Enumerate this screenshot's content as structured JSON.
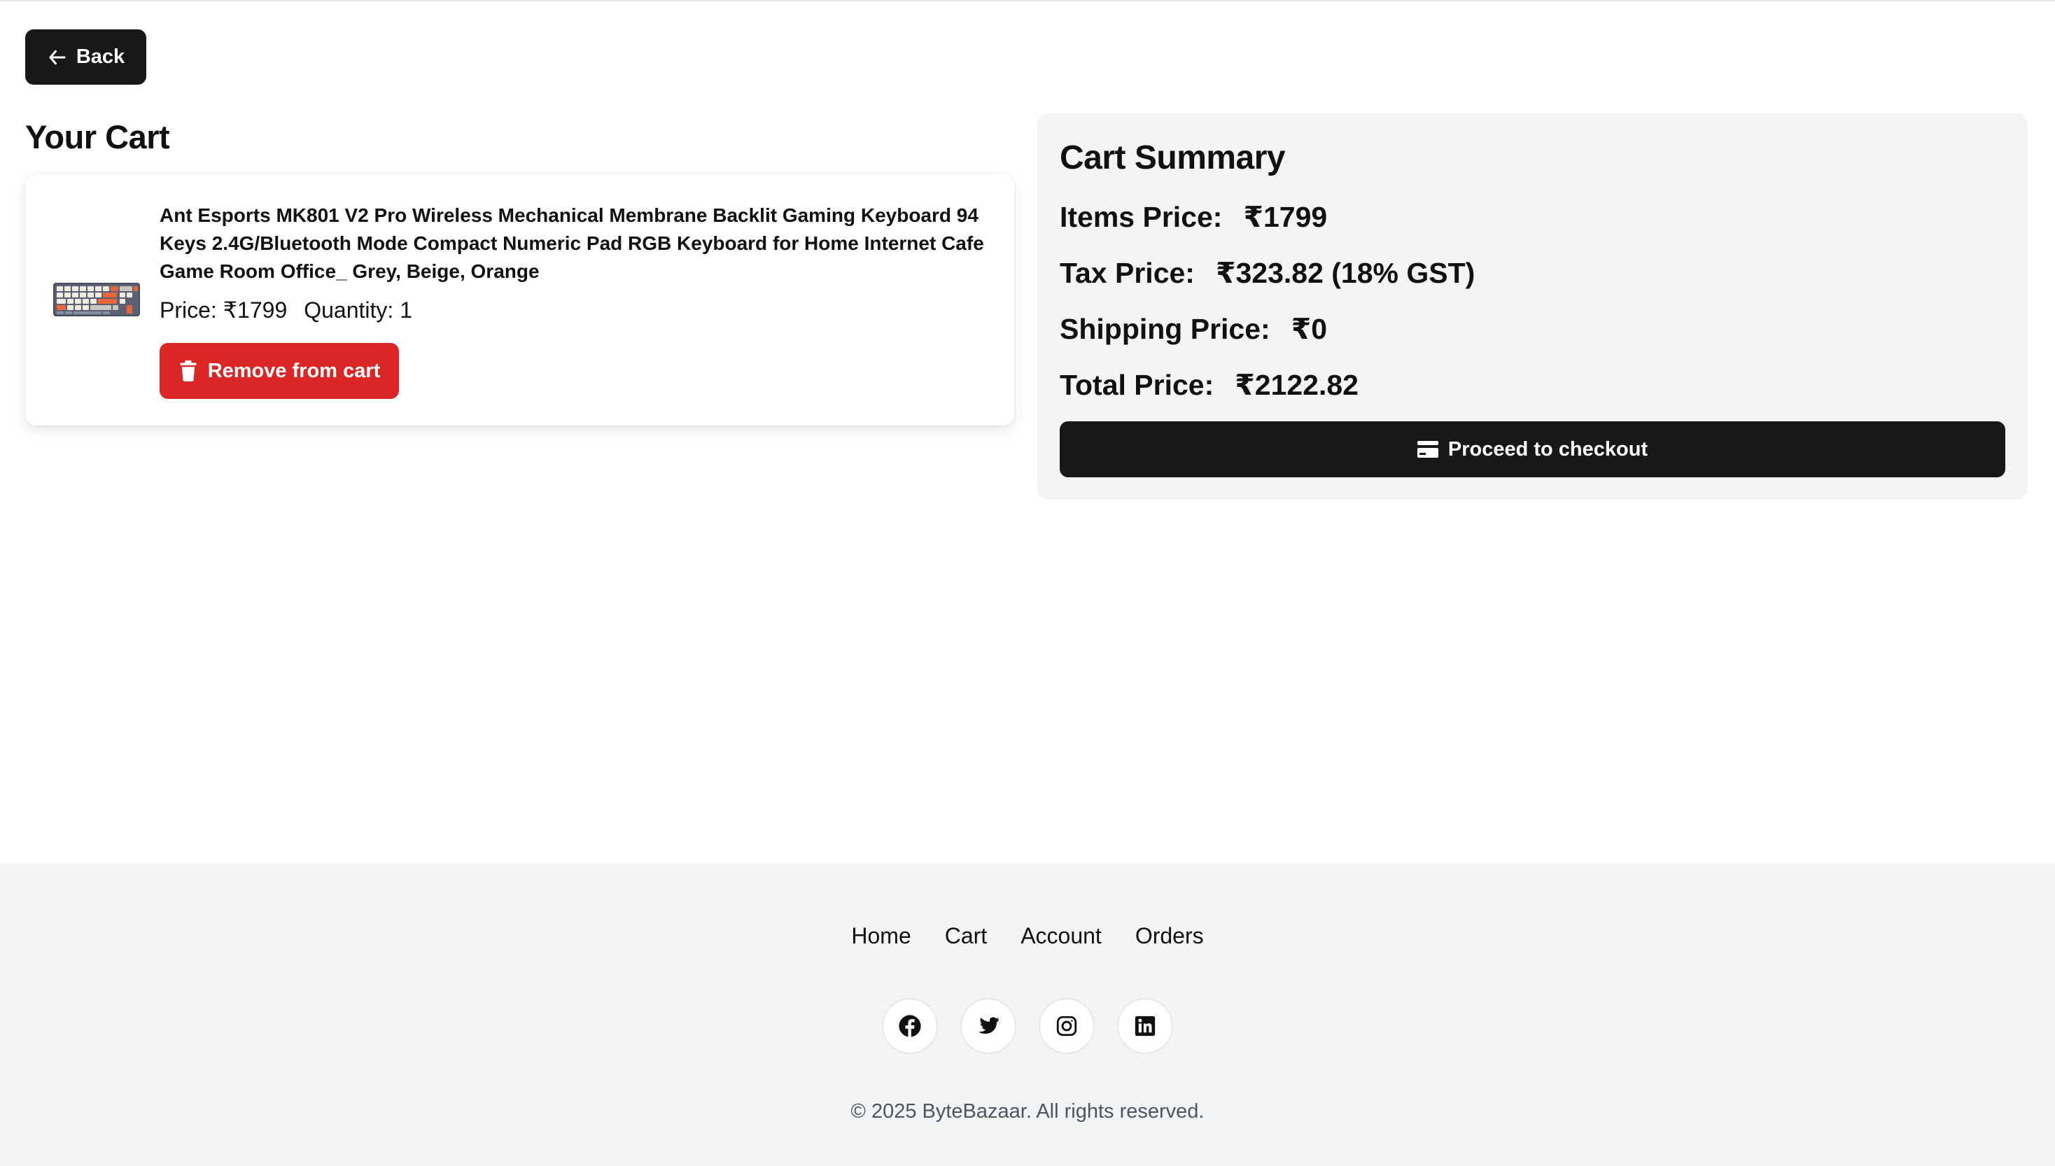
{
  "nav": {
    "back_label": "Back"
  },
  "cart": {
    "title": "Your Cart",
    "items": [
      {
        "name": "Ant Esports MK801 V2 Pro Wireless Mechanical Membrane Backlit Gaming Keyboard 94 Keys 2.4G/Bluetooth Mode Compact Numeric Pad RGB Keyboard for Home Internet Cafe Game Room Office_ Grey, Beige, Orange",
        "price_text": "Price: ₹1799",
        "quantity_text": "Quantity: 1",
        "remove_label": "Remove from cart"
      }
    ]
  },
  "summary": {
    "title": "Cart Summary",
    "items_label": "Items Price:",
    "items_value": "₹1799",
    "tax_label": "Tax Price:",
    "tax_value": "₹323.82 (18% GST)",
    "shipping_label": "Shipping Price:",
    "shipping_value": "₹0",
    "total_label": "Total Price:",
    "total_value": "₹2122.82",
    "checkout_label": "Proceed to checkout"
  },
  "footer": {
    "links": [
      "Home",
      "Cart",
      "Account",
      "Orders"
    ],
    "social_icons": [
      "facebook-icon",
      "twitter-icon",
      "instagram-icon",
      "linkedin-icon"
    ],
    "copyright": "© 2025 ByteBazaar. All rights reserved."
  },
  "colors": {
    "primary": "#18181b",
    "danger": "#dc2626",
    "panel_bg": "#f3f4f6",
    "text": "#111111",
    "muted_text": "#4b5563"
  }
}
